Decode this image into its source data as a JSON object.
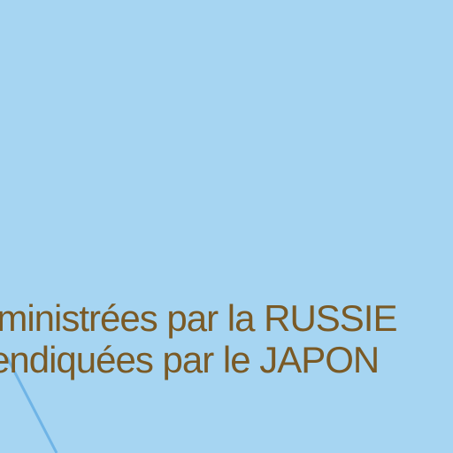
{
  "map": {
    "colors": {
      "sea": "#a6d5f2",
      "label": "#7a5a26",
      "route": "#6fb4e6"
    },
    "label": {
      "line1": "lministrées par la RUSSIE",
      "line2": "endiquées par le JAPON"
    }
  }
}
